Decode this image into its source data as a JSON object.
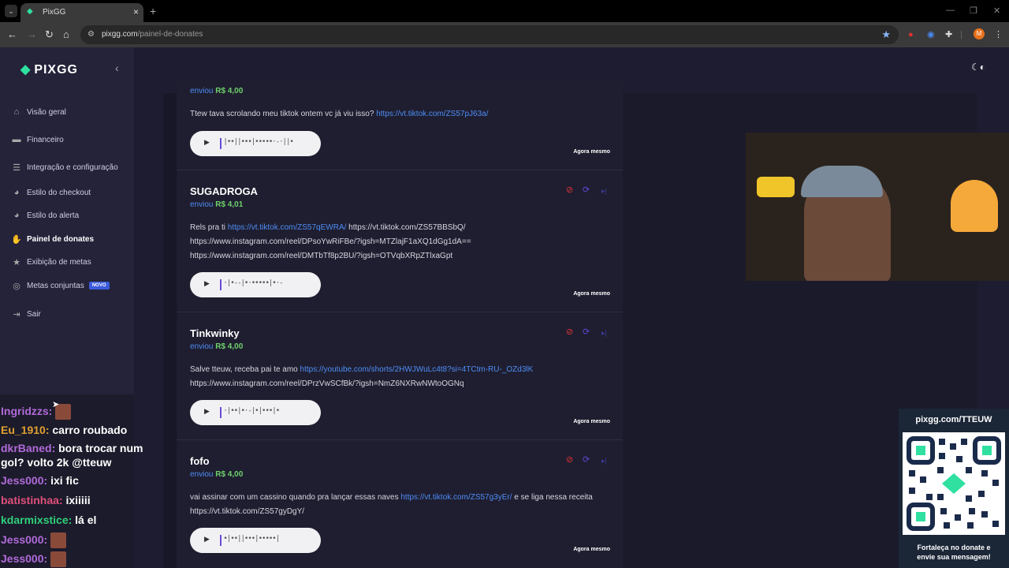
{
  "browser": {
    "tab_title": "PixGG",
    "url_domain": "pixgg.com",
    "url_path": "/painel-de-donates",
    "profile_initial": "M"
  },
  "sidebar": {
    "logo": "PIXGG",
    "items": [
      {
        "label": "Visão geral",
        "icon": "home-icon",
        "active": false
      },
      {
        "label": "Financeiro",
        "icon": "wallet-icon",
        "active": false
      },
      {
        "label": "Integração e configuração",
        "icon": "settings-icon",
        "active": false
      },
      {
        "label": "Estilo do checkout",
        "icon": "palette-icon",
        "active": false
      },
      {
        "label": "Estilo do alerta",
        "icon": "palette-icon",
        "active": false
      },
      {
        "label": "Painel de donates",
        "icon": "donate-icon",
        "active": true
      },
      {
        "label": "Exibição de metas",
        "icon": "star-icon",
        "active": false
      },
      {
        "label": "Metas conjuntas",
        "icon": "target-icon",
        "active": false,
        "badge": "NOVO"
      },
      {
        "label": "Sair",
        "icon": "logout-icon",
        "active": false
      }
    ]
  },
  "donations": [
    {
      "name": "",
      "sent_label": "enviou",
      "amount": "R$ 4,00",
      "message_parts": [
        {
          "text": "Ttew tava scrolando meu tiktok ontem vc já viu isso? ",
          "link": false
        },
        {
          "text": "https://vt.tiktok.com/ZS57pJ63a/",
          "link": true
        }
      ],
      "time": "Agora mesmo"
    },
    {
      "name": "SUGADROGA",
      "sent_label": "enviou",
      "amount": "R$ 4,01",
      "message_parts": [
        {
          "text": "Rels pra ti ",
          "link": false
        },
        {
          "text": "https://vt.tiktok.com/ZS57qEWRA/",
          "link": true
        },
        {
          "text": " https://vt.tiktok.com/ZS57BBSbQ/ https://www.instagram.com/reel/DPsoYwRiFBe/?igsh=MTZlajF1aXQ1dGg1dA== https://www.instagram.com/reel/DMTbTf8p2BU/?igsh=OTVqbXRpZTlxaGpt",
          "link": false
        }
      ],
      "time": "Agora mesmo"
    },
    {
      "name": "Tinkwinky",
      "sent_label": "enviou",
      "amount": "R$ 4,00",
      "message_parts": [
        {
          "text": "Salve tteuw, receba pai te amo ",
          "link": false
        },
        {
          "text": "https://youtube.com/shorts/2HWJWuLc4t8?si=4TCtm-RU-_OZd3lK",
          "link": true
        },
        {
          "text": " https://www.instagram.com/reel/DPrzVwSCfBk/?igsh=NmZ6NXRwNWtoOGNq",
          "link": false
        }
      ],
      "time": "Agora mesmo"
    },
    {
      "name": "fofo",
      "sent_label": "enviou",
      "amount": "R$ 4,00",
      "message_parts": [
        {
          "text": "vai assinar com um cassino quando pra lançar essas naves ",
          "link": false
        },
        {
          "text": "https://vt.tiktok.com/ZS57g3yEr/",
          "link": true
        },
        {
          "text": " e se liga nessa receita https://vt.tiktok.com/ZS57gyDgY/",
          "link": false
        }
      ],
      "time": "Agora mesmo"
    }
  ],
  "chat": [
    {
      "name": "Ingridzzs:",
      "message": "",
      "color": "#b06ad9",
      "emote": true
    },
    {
      "name": "Eu_1910:",
      "message": "carro roubado",
      "color": "#e0a030"
    },
    {
      "name": "dkrBaned:",
      "message": "bora trocar num gol? volto 2k @tteuw",
      "color": "#b06ad9"
    },
    {
      "name": "Jess000:",
      "message": "ixi fic",
      "color": "#b06ad9"
    },
    {
      "name": "batistinhaa:",
      "message": "ixiiiii",
      "color": "#e0507a"
    },
    {
      "name": "kdarmixstice:",
      "message": "lá el",
      "color": "#2fd07a"
    },
    {
      "name": "Jess000:",
      "message": "",
      "color": "#b06ad9",
      "emote": true
    },
    {
      "name": "Jess000:",
      "message": "",
      "color": "#b06ad9",
      "emote": true
    }
  ],
  "qr_panel": {
    "title": "pixgg.com/TTEUW",
    "caption_line1": "Fortaleça no donate e",
    "caption_line2": "envie sua mensagem!"
  },
  "colors": {
    "brand": "#2fe0a0",
    "link": "#4d8df6",
    "amount": "#6ed16b",
    "block": "#dd3333"
  }
}
